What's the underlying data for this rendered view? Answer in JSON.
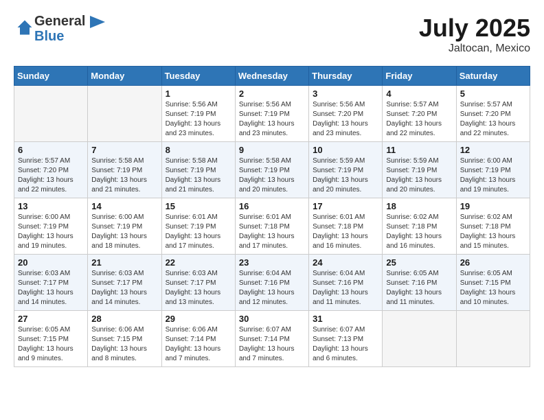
{
  "logo": {
    "line1": "General",
    "line2": "Blue"
  },
  "title": "July 2025",
  "location": "Jaltocan, Mexico",
  "days_of_week": [
    "Sunday",
    "Monday",
    "Tuesday",
    "Wednesday",
    "Thursday",
    "Friday",
    "Saturday"
  ],
  "weeks": [
    [
      {
        "day": "",
        "content": ""
      },
      {
        "day": "",
        "content": ""
      },
      {
        "day": "1",
        "content": "Sunrise: 5:56 AM\nSunset: 7:19 PM\nDaylight: 13 hours and 23 minutes."
      },
      {
        "day": "2",
        "content": "Sunrise: 5:56 AM\nSunset: 7:19 PM\nDaylight: 13 hours and 23 minutes."
      },
      {
        "day": "3",
        "content": "Sunrise: 5:56 AM\nSunset: 7:20 PM\nDaylight: 13 hours and 23 minutes."
      },
      {
        "day": "4",
        "content": "Sunrise: 5:57 AM\nSunset: 7:20 PM\nDaylight: 13 hours and 22 minutes."
      },
      {
        "day": "5",
        "content": "Sunrise: 5:57 AM\nSunset: 7:20 PM\nDaylight: 13 hours and 22 minutes."
      }
    ],
    [
      {
        "day": "6",
        "content": "Sunrise: 5:57 AM\nSunset: 7:20 PM\nDaylight: 13 hours and 22 minutes."
      },
      {
        "day": "7",
        "content": "Sunrise: 5:58 AM\nSunset: 7:19 PM\nDaylight: 13 hours and 21 minutes."
      },
      {
        "day": "8",
        "content": "Sunrise: 5:58 AM\nSunset: 7:19 PM\nDaylight: 13 hours and 21 minutes."
      },
      {
        "day": "9",
        "content": "Sunrise: 5:58 AM\nSunset: 7:19 PM\nDaylight: 13 hours and 20 minutes."
      },
      {
        "day": "10",
        "content": "Sunrise: 5:59 AM\nSunset: 7:19 PM\nDaylight: 13 hours and 20 minutes."
      },
      {
        "day": "11",
        "content": "Sunrise: 5:59 AM\nSunset: 7:19 PM\nDaylight: 13 hours and 20 minutes."
      },
      {
        "day": "12",
        "content": "Sunrise: 6:00 AM\nSunset: 7:19 PM\nDaylight: 13 hours and 19 minutes."
      }
    ],
    [
      {
        "day": "13",
        "content": "Sunrise: 6:00 AM\nSunset: 7:19 PM\nDaylight: 13 hours and 19 minutes."
      },
      {
        "day": "14",
        "content": "Sunrise: 6:00 AM\nSunset: 7:19 PM\nDaylight: 13 hours and 18 minutes."
      },
      {
        "day": "15",
        "content": "Sunrise: 6:01 AM\nSunset: 7:19 PM\nDaylight: 13 hours and 17 minutes."
      },
      {
        "day": "16",
        "content": "Sunrise: 6:01 AM\nSunset: 7:18 PM\nDaylight: 13 hours and 17 minutes."
      },
      {
        "day": "17",
        "content": "Sunrise: 6:01 AM\nSunset: 7:18 PM\nDaylight: 13 hours and 16 minutes."
      },
      {
        "day": "18",
        "content": "Sunrise: 6:02 AM\nSunset: 7:18 PM\nDaylight: 13 hours and 16 minutes."
      },
      {
        "day": "19",
        "content": "Sunrise: 6:02 AM\nSunset: 7:18 PM\nDaylight: 13 hours and 15 minutes."
      }
    ],
    [
      {
        "day": "20",
        "content": "Sunrise: 6:03 AM\nSunset: 7:17 PM\nDaylight: 13 hours and 14 minutes."
      },
      {
        "day": "21",
        "content": "Sunrise: 6:03 AM\nSunset: 7:17 PM\nDaylight: 13 hours and 14 minutes."
      },
      {
        "day": "22",
        "content": "Sunrise: 6:03 AM\nSunset: 7:17 PM\nDaylight: 13 hours and 13 minutes."
      },
      {
        "day": "23",
        "content": "Sunrise: 6:04 AM\nSunset: 7:16 PM\nDaylight: 13 hours and 12 minutes."
      },
      {
        "day": "24",
        "content": "Sunrise: 6:04 AM\nSunset: 7:16 PM\nDaylight: 13 hours and 11 minutes."
      },
      {
        "day": "25",
        "content": "Sunrise: 6:05 AM\nSunset: 7:16 PM\nDaylight: 13 hours and 11 minutes."
      },
      {
        "day": "26",
        "content": "Sunrise: 6:05 AM\nSunset: 7:15 PM\nDaylight: 13 hours and 10 minutes."
      }
    ],
    [
      {
        "day": "27",
        "content": "Sunrise: 6:05 AM\nSunset: 7:15 PM\nDaylight: 13 hours and 9 minutes."
      },
      {
        "day": "28",
        "content": "Sunrise: 6:06 AM\nSunset: 7:15 PM\nDaylight: 13 hours and 8 minutes."
      },
      {
        "day": "29",
        "content": "Sunrise: 6:06 AM\nSunset: 7:14 PM\nDaylight: 13 hours and 7 minutes."
      },
      {
        "day": "30",
        "content": "Sunrise: 6:07 AM\nSunset: 7:14 PM\nDaylight: 13 hours and 7 minutes."
      },
      {
        "day": "31",
        "content": "Sunrise: 6:07 AM\nSunset: 7:13 PM\nDaylight: 13 hours and 6 minutes."
      },
      {
        "day": "",
        "content": ""
      },
      {
        "day": "",
        "content": ""
      }
    ]
  ]
}
